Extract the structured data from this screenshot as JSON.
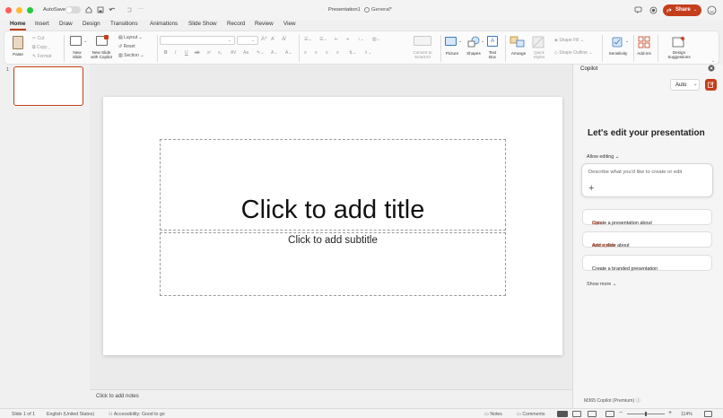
{
  "titlebar": {
    "autosave_label": "AutoSave",
    "document_title": "Presentation1",
    "sensitivity_label": "General*",
    "share_label": "Share"
  },
  "tabs": [
    "Home",
    "Insert",
    "Draw",
    "Design",
    "Transitions",
    "Animations",
    "Slide Show",
    "Record",
    "Review",
    "View"
  ],
  "ribbon": {
    "paste": "Paste",
    "cut": "Cut",
    "copy": "Copy",
    "format": "Format",
    "new_slide_1": "New",
    "new_slide_2": "Slide",
    "copilot_slide_1": "New Slide",
    "copilot_slide_2": "with Copilot",
    "layout": "Layout",
    "reset": "Reset",
    "section": "Section",
    "convert_1": "Convert to",
    "convert_2": "SmartArt",
    "picture": "Picture",
    "shapes": "Shapes",
    "textbox_1": "Text",
    "textbox_2": "Box",
    "arrange": "Arrange",
    "quick_styles_1": "Quick",
    "quick_styles_2": "Styles",
    "shape_fill": "Shape Fill",
    "shape_outline": "Shape Outline",
    "sensitivity": "Sensitivity",
    "addins": "Add-ins",
    "design_1": "Design",
    "design_2": "Suggestions"
  },
  "thumbnail": {
    "number": "1"
  },
  "slide": {
    "title_placeholder": "Click to add title",
    "subtitle_placeholder": "Click to add subtitle"
  },
  "notes_placeholder": "Click to add notes",
  "copilot": {
    "header": "Copilot",
    "mode": "Auto",
    "heading": "Let's edit your presentation",
    "allow_editing": "Allow editing",
    "prompt_placeholder": "Describe what you'd like to create or edit",
    "suggestions": [
      {
        "text": "Create a presentation about ",
        "keyword": "topic"
      },
      {
        "text": "Add a slide about ",
        "keyword": "description"
      },
      {
        "text": "Create a branded presentation",
        "keyword": ""
      }
    ],
    "show_more": "Show more",
    "footer": "M365 Copilot (Premium)"
  },
  "status": {
    "slide_info": "Slide 1 of 1",
    "language": "English (United States)",
    "accessibility": "Accessibility: Good to go",
    "notes": "Notes",
    "comments": "Comments",
    "zoom": "114%"
  },
  "colors": {
    "accent": "#c43e1c",
    "active_tab": "#c43e1c",
    "link_keyword": "#c43e1c"
  }
}
